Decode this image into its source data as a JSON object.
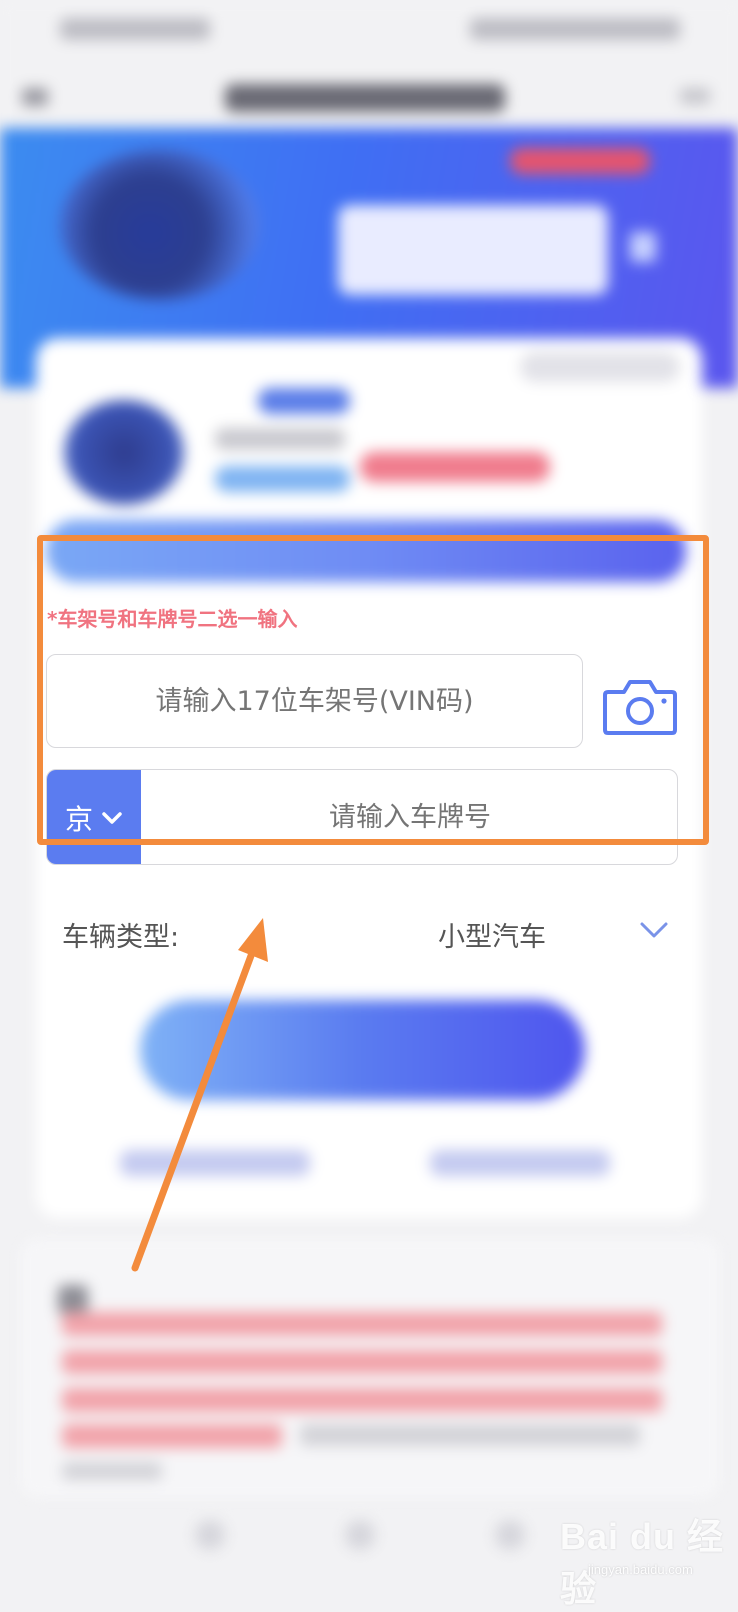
{
  "form": {
    "hint": "*车架号和车牌号二选一输入",
    "vin_placeholder": "请输入17位车架号(VIN码)",
    "plate_province": "京",
    "plate_placeholder": "请输入车牌号",
    "vehicle_type_label": "车辆类型:",
    "vehicle_type_value": "小型汽车"
  },
  "icons": {
    "camera": "camera-icon",
    "province_dropdown": "chevron-down-icon",
    "vehicle_type_dropdown": "chevron-down-icon"
  },
  "watermark": {
    "brand": "Bai du 经验",
    "url": "jingyan.baidu.com"
  },
  "annotation": {
    "highlight_color": "#f38b3c",
    "accent_color": "#5b7cf0",
    "hint_color": "#f07380"
  }
}
